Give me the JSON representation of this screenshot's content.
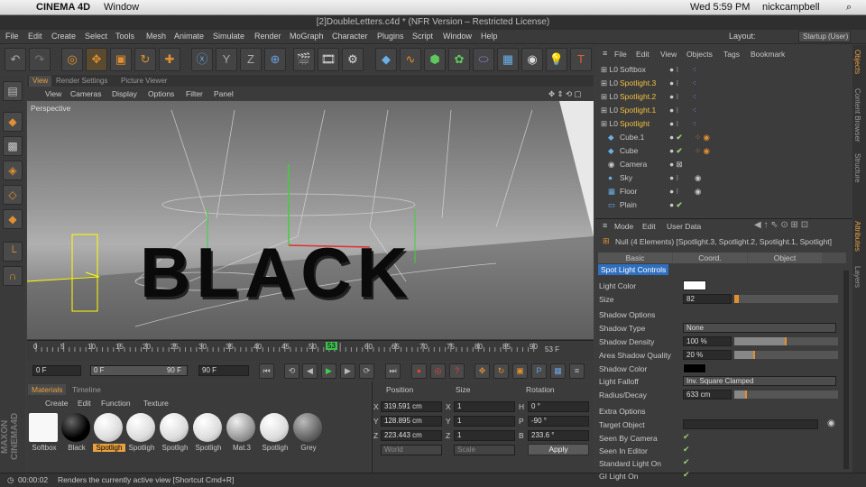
{
  "mac_menu": {
    "app": "CINEMA 4D",
    "window": "Window",
    "clock": "Wed 5:59 PM",
    "user": "nickcampbell"
  },
  "title": "[2]DoubleLetters.c4d * (NFR Version – Restricted License)",
  "menu": [
    "File",
    "Edit",
    "Create",
    "Select",
    "Tools",
    "Mesh",
    "Animate",
    "Simulate",
    "Render",
    "MoGraph",
    "Character",
    "Plugins",
    "Script",
    "Window",
    "Help"
  ],
  "layout": {
    "label": "Layout:",
    "value": "Startup (User)"
  },
  "viewport_tabs": [
    "View",
    "Render Settings",
    "Picture Viewer"
  ],
  "viewport_menu": [
    "View",
    "Cameras",
    "Display",
    "Options",
    "Filter",
    "Panel"
  ],
  "viewport_label": "Perspective",
  "scene_text": "BLACK",
  "timeline": {
    "ticks": [
      "0",
      "5",
      "10",
      "15",
      "20",
      "25",
      "30",
      "35",
      "40",
      "45",
      "50",
      "53",
      "60",
      "65",
      "70",
      "75",
      "80",
      "85",
      "90"
    ],
    "current": "53 F"
  },
  "playback": {
    "start": "0 F",
    "range_start": "0 F",
    "range_end": "90 F",
    "end": "90 F"
  },
  "materials": {
    "tabs": [
      "Materials",
      "Timeline"
    ],
    "menu": [
      "Create",
      "Edit",
      "Function",
      "Texture"
    ],
    "items": [
      "Softbox",
      "Black",
      "Spotligh",
      "Spotligh",
      "Spotligh",
      "Spotligh",
      "Mat.3",
      "Spotligh",
      "Grey"
    ]
  },
  "coords": {
    "headers": [
      "Position",
      "Size",
      "Rotation"
    ],
    "rows": [
      [
        "X",
        "319.591 cm",
        "X",
        "1",
        "H",
        "0 °"
      ],
      [
        "Y",
        "128.895 cm",
        "Y",
        "1",
        "P",
        "-90 °"
      ],
      [
        "Z",
        "223.443 cm",
        "Z",
        "1",
        "B",
        "233.6 °"
      ]
    ],
    "world": "World",
    "scale": "Scale",
    "apply": "Apply"
  },
  "status": {
    "time": "00:00:02",
    "message": "Renders the currently active view [Shortcut Cmd+R]"
  },
  "objects": {
    "menu": [
      "File",
      "Edit",
      "View",
      "Objects",
      "Tags",
      "Bookmark"
    ],
    "items": [
      "Softbox",
      "Spotlight.3",
      "Spotlight.2",
      "Spotlight.1",
      "Spotlight",
      "Cube.1",
      "Cube",
      "Camera",
      "Sky",
      "Floor",
      "Plain"
    ]
  },
  "attributes": {
    "menu": [
      "Mode",
      "Edit",
      "User Data"
    ],
    "header": "Null (4 Elements) [Spotlight.3, Spotlight.2, Spotlight.1, Spotlight]",
    "tabs": [
      "Basic",
      "Coord.",
      "Object"
    ],
    "active_tab": "Spot Light Controls",
    "light_color_label": "Light Color",
    "size_label": "Size",
    "size": "82",
    "shadow_section": "Shadow Options",
    "shadow_type_label": "Shadow Type",
    "shadow_type": "None",
    "shadow_density_label": "Shadow Density",
    "shadow_density": "100 %",
    "area_quality_label": "Area Shadow Quality",
    "area_quality": "20 %",
    "shadow_color_label": "Shadow Color",
    "light_falloff_label": "Light Falloff",
    "light_falloff": "Inv. Square Clamped",
    "radius_label": "Radius/Decay",
    "radius": "633 cm",
    "extra_section": "Extra Options",
    "target_label": "Target Object",
    "seen_camera": "Seen By Camera",
    "seen_editor": "Seen In Editor",
    "standard_light": "Standard Light On",
    "gi_light": "GI Light On"
  },
  "side_tabs": [
    "Objects",
    "Content Browser",
    "Structure",
    "Attributes",
    "Layers"
  ],
  "brand": "MAXON CINEMA4D",
  "colors": {
    "accent": "#e8a040",
    "selected_text": "#f0c040",
    "active_tab_bg": "#2f6fbf"
  }
}
